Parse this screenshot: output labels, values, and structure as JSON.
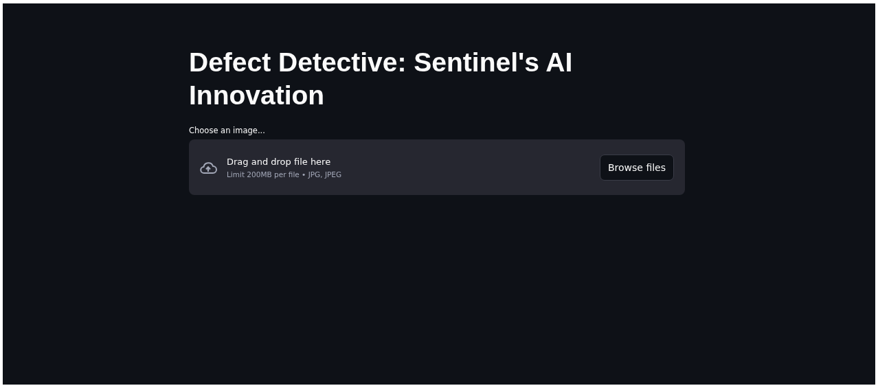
{
  "title": "Defect Detective: Sentinel's AI Innovation",
  "uploader": {
    "label": "Choose an image...",
    "instruction": "Drag and drop file here",
    "limit": "Limit 200MB per file • JPG, JPEG",
    "button": "Browse files"
  }
}
